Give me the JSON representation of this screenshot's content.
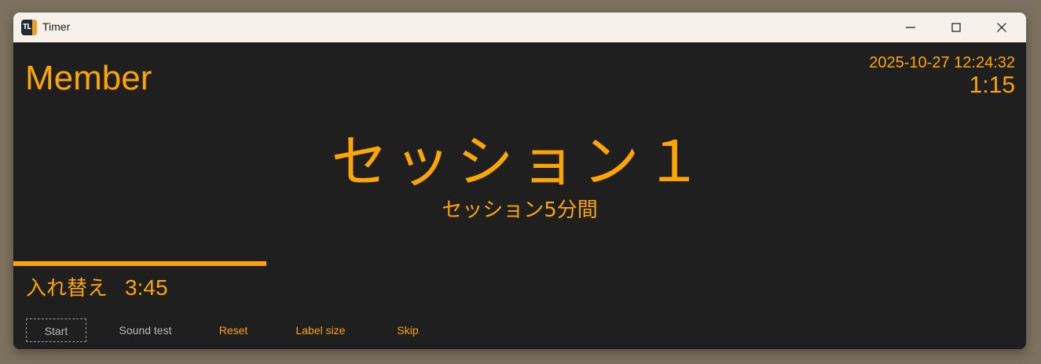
{
  "window": {
    "title": "Timer",
    "icon_text": "TL"
  },
  "colors": {
    "accent": "#ffa500",
    "background": "#1f1f1f",
    "titlebar": "#f7f1e9",
    "muted_button": "#b8b8b8"
  },
  "header": {
    "member_label": "Member",
    "datetime": "2025-10-27 12:24:32",
    "elapsed": "1:15"
  },
  "session": {
    "title": "セッション１",
    "subtitle": "セッション5分間"
  },
  "progress": {
    "fraction": 0.25
  },
  "next": {
    "label": "入れ替え",
    "time": "3:45"
  },
  "toolbar": {
    "start_label": "Start",
    "sound_test_label": "Sound test",
    "reset_label": "Reset",
    "label_size_label": "Label size",
    "skip_label": "Skip"
  },
  "icons": {
    "minimize": "minimize-icon",
    "maximize": "maximize-icon",
    "close": "close-icon"
  }
}
